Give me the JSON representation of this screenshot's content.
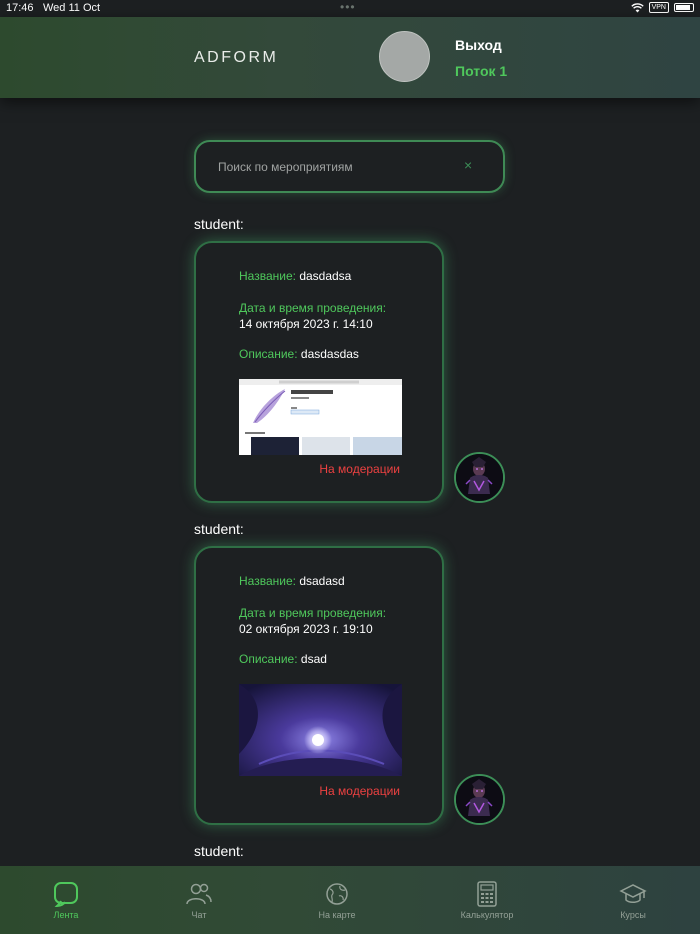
{
  "status_bar": {
    "time": "17:46",
    "date": "Wed 11 Oct",
    "vpn": "VPN"
  },
  "header": {
    "logo": "ADFORM",
    "logout": "Выход",
    "stream": "Поток 1"
  },
  "search": {
    "placeholder": "Поиск по мероприятиям",
    "value": "",
    "clear": "×"
  },
  "feed": [
    {
      "author": "student:",
      "name_label": "Название:",
      "name": "dasdadsa",
      "date_label": "Дата и время проведения:",
      "date": "14 октября 2023 г. 14:10",
      "desc_label": "Описание:",
      "desc": "dasdasdas",
      "image": "lightshot-screenshot-image",
      "status": "На модерации"
    },
    {
      "author": "student:",
      "name_label": "Название:",
      "name": "dsadasd",
      "date_label": "Дата и время проведения:",
      "date": "02 октября 2023 г. 19:10",
      "desc_label": "Описание:",
      "desc": "dsad",
      "image": "night-sky-moon-image",
      "status": "На модерации"
    },
    {
      "author": "student:"
    }
  ],
  "nav": [
    {
      "label": "Лента",
      "icon": "feed-icon",
      "active": true
    },
    {
      "label": "Чат",
      "icon": "users-icon",
      "active": false
    },
    {
      "label": "На карте",
      "icon": "globe-icon",
      "active": false
    },
    {
      "label": "Калькулятор",
      "icon": "calculator-icon",
      "active": false
    },
    {
      "label": "Курсы",
      "icon": "graduation-cap-icon",
      "active": false
    }
  ],
  "colors": {
    "accent": "#4fc85c",
    "status_moderation": "#ec4141",
    "background": "#1d2022"
  }
}
